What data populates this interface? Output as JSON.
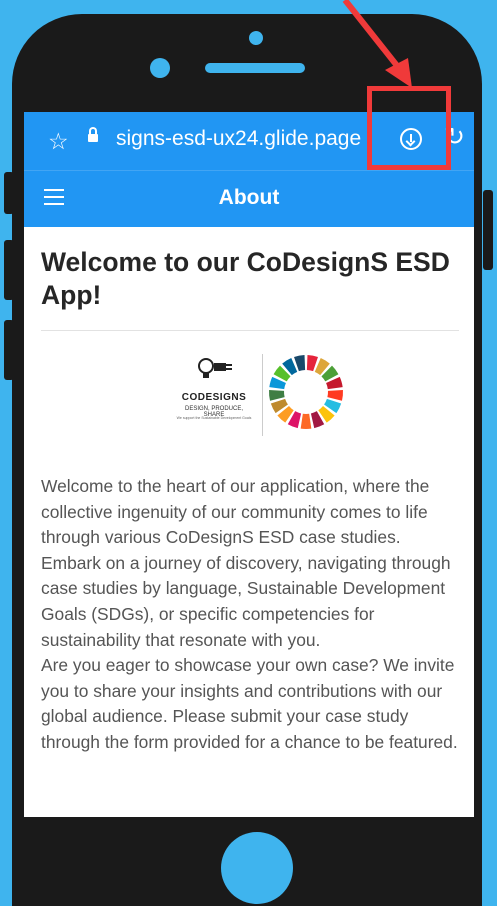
{
  "browser": {
    "url_text": "signs-esd-ux24.glide.page",
    "star_icon": "star-outline-icon",
    "lock_icon": "lock-icon",
    "download_icon": "download-circle-icon",
    "reload_icon": "reload-icon"
  },
  "appbar": {
    "title": "About",
    "menu_icon": "hamburger-menu-icon"
  },
  "content": {
    "heading": "Welcome to our CoDesignS ESD App!",
    "logo": {
      "name": "CODESIGNS",
      "tagline": "DESIGN, PRODUCE, SHARE",
      "small": "We support the Sustainable Development Goals"
    },
    "paragraph_1": "Welcome to the heart of our application, where the collective ingenuity of our community comes to life through various CoDesignS ESD case studies. Embark on a journey of discovery, navigating through case studies by language, Sustainable Development Goals (SDGs), or specific competencies for sustainability that resonate with you.",
    "paragraph_2": "Are you eager to showcase your own case? We invite you to share your insights and contributions with our global audience. Please submit your case study through the form provided for a chance to be featured."
  },
  "colors": {
    "background": "#3fb4ee",
    "phone_body": "#1a1a1a",
    "appbar": "#2196f3",
    "highlight": "#f03a3a"
  }
}
